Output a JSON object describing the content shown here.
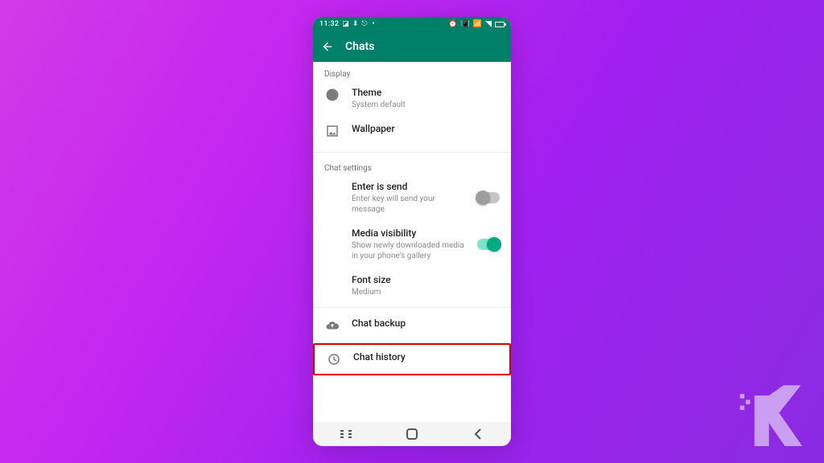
{
  "statusbar": {
    "time": "11:32"
  },
  "appbar": {
    "title": "Chats"
  },
  "sections": {
    "display": {
      "header": "Display",
      "theme": {
        "title": "Theme",
        "subtitle": "System default"
      },
      "wallpaper": {
        "title": "Wallpaper"
      }
    },
    "chat_settings": {
      "header": "Chat settings",
      "enter_is_send": {
        "title": "Enter is send",
        "subtitle": "Enter key will send your message",
        "toggle": false
      },
      "media_visibility": {
        "title": "Media visibility",
        "subtitle": "Show newly downloaded media in your phone's gallery",
        "toggle": true
      },
      "font_size": {
        "title": "Font size",
        "subtitle": "Medium"
      }
    },
    "backup": {
      "title": "Chat backup"
    },
    "history": {
      "title": "Chat history"
    }
  }
}
